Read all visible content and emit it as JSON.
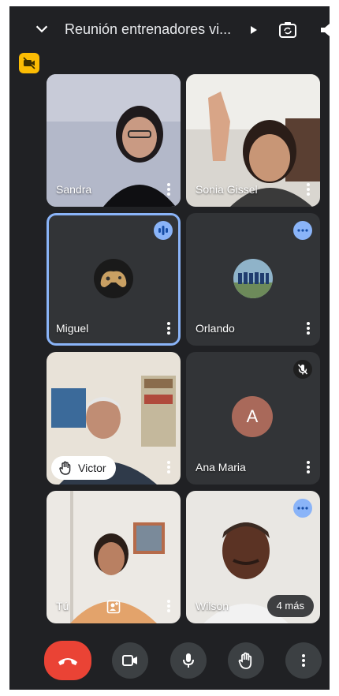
{
  "header": {
    "meeting_title": "Reunión entrenadores vi..."
  },
  "participants": [
    {
      "name": "Sandra"
    },
    {
      "name": "Sonia Gissel"
    },
    {
      "name": "Miguel"
    },
    {
      "name": "Orlando"
    },
    {
      "name": "Victor"
    },
    {
      "name": "Ana Maria",
      "initial": "A"
    },
    {
      "name": "Tú"
    },
    {
      "name": "Wilson"
    }
  ],
  "overflow": {
    "label": "4 más"
  },
  "colors": {
    "background": "#202124",
    "tile": "#3c4043",
    "speaking_outline": "#8ab4f8",
    "end_call": "#ea4335",
    "camera_off_badge": "#fbbc04"
  }
}
